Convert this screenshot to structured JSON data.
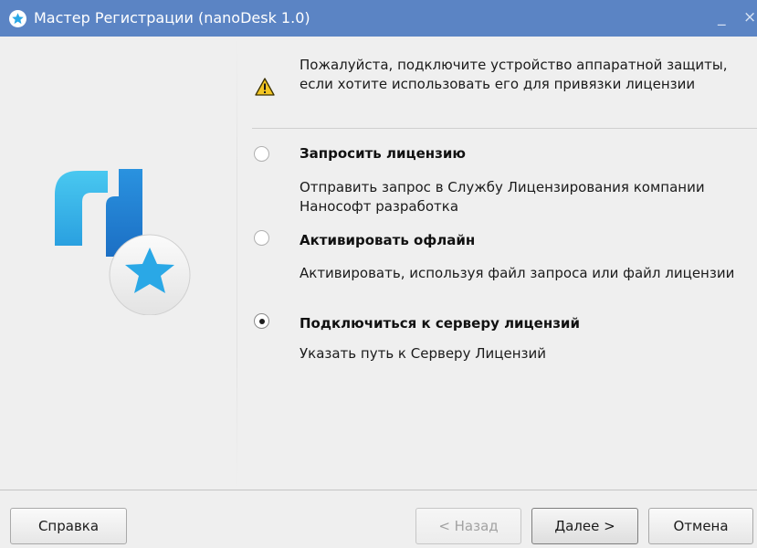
{
  "window": {
    "title": "Мастер Регистрации (nanoDesk 1.0)",
    "minimize_glyph": "_",
    "close_glyph": "×"
  },
  "warning": {
    "icon": "warning-triangle-icon",
    "text": "Пожалуйста, подключите устройство аппаратной защиты, если хотите использовать его для привязки лицензии"
  },
  "options": [
    {
      "label": "Запросить лицензию",
      "description": "Отправить запрос в Службу Лицензирования компании Нанософт разработка",
      "selected": false
    },
    {
      "label": "Активировать офлайн",
      "description": "Активировать, используя файл запроса или файл лицензии",
      "selected": false
    },
    {
      "label": "Подключиться к серверу лицензий",
      "description": "Указать путь к Серверу Лицензий",
      "selected": true
    }
  ],
  "buttons": {
    "help": "Справка",
    "back": "< Назад",
    "next": "Далее >",
    "cancel": "Отмена"
  },
  "colors": {
    "titlebar": "#5b84c4",
    "logo_cyan": "#38b6e8",
    "logo_blue": "#1f7fd0",
    "star": "#2aa8e6",
    "warning_yellow": "#f3c623"
  }
}
